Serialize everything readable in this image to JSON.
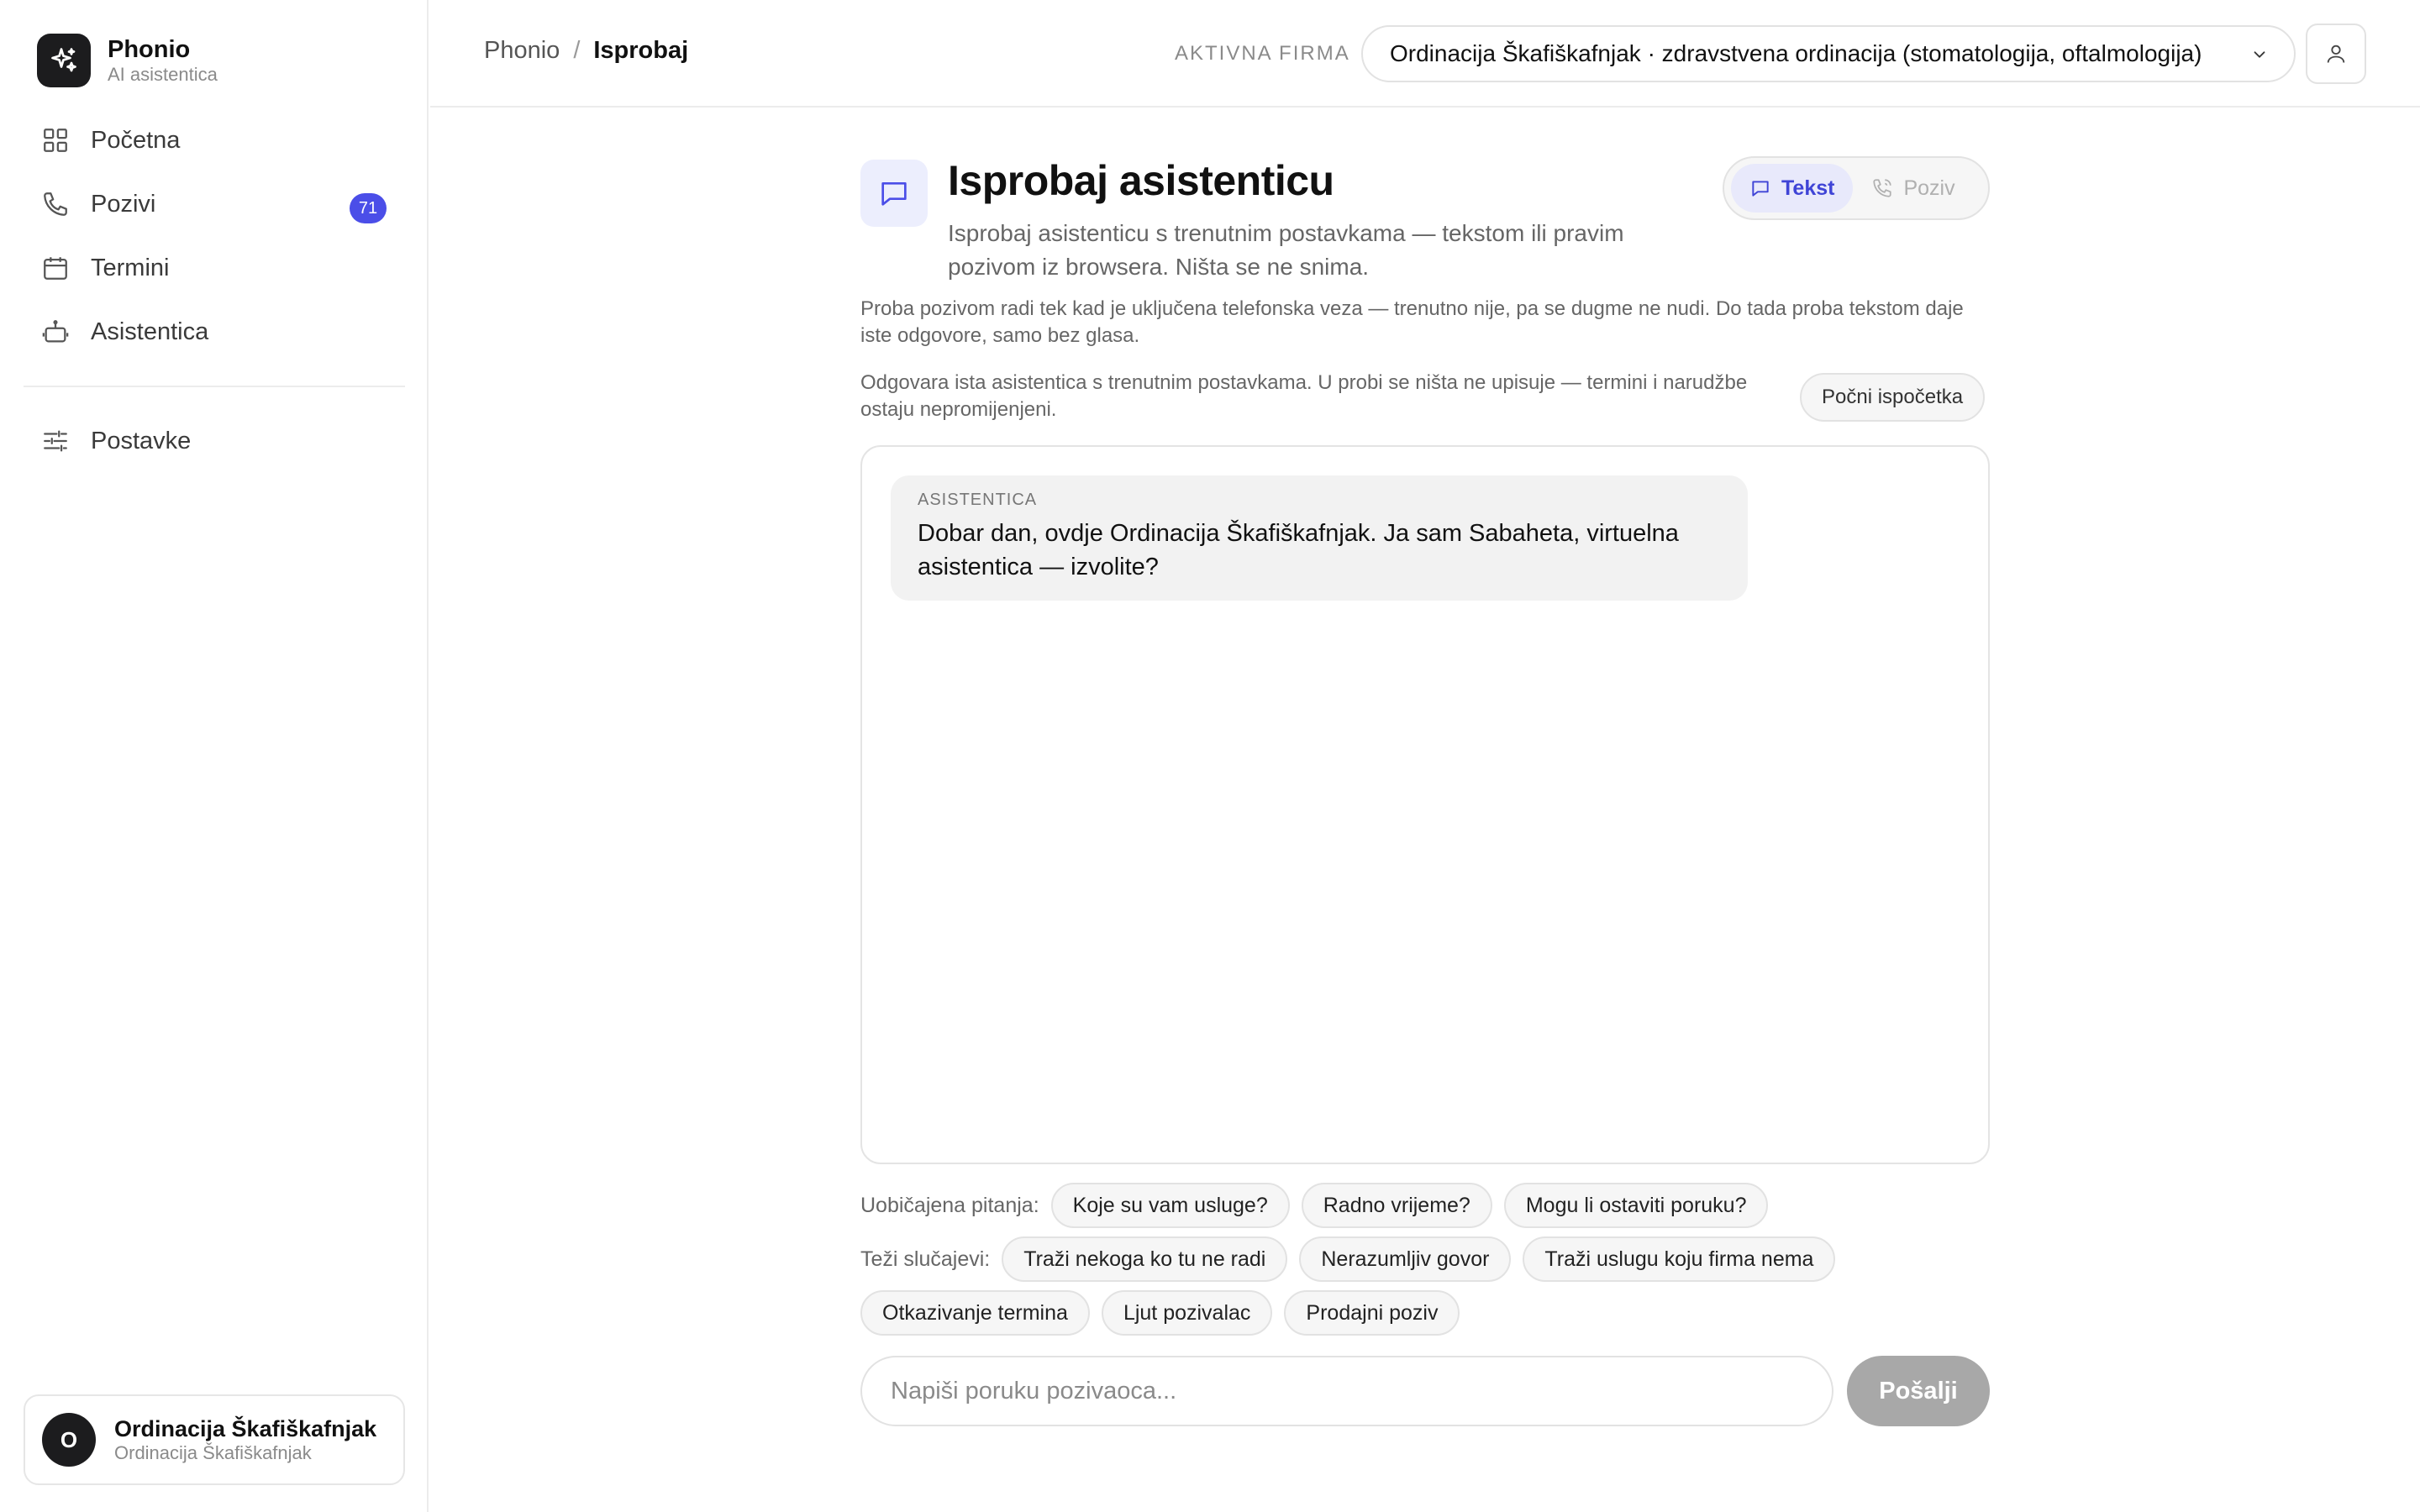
{
  "brand": {
    "name": "Phonio",
    "subtitle": "AI asistentica",
    "icon": "sparkle-icon"
  },
  "sidebar": {
    "items": [
      {
        "label": "Početna",
        "icon": "grid-icon"
      },
      {
        "label": "Pozivi",
        "icon": "phone-icon",
        "badge": "71"
      },
      {
        "label": "Termini",
        "icon": "calendar-icon"
      },
      {
        "label": "Asistentica",
        "icon": "robot-icon"
      }
    ],
    "secondary": [
      {
        "label": "Postavke",
        "icon": "sliders-icon"
      }
    ],
    "account": {
      "initial": "O",
      "name": "Ordinacija Škafiškafnjak",
      "subtitle": "Ordinacija Škafiškafnjak"
    }
  },
  "topbar": {
    "breadcrumb_root": "Phonio",
    "breadcrumb_separator": "/",
    "breadcrumb_current": "Isprobaj",
    "firm_label": "AKTIVNA FIRMA",
    "firm_value": "Ordinacija Škafiškafnjak · zdravstvena ordinacija (stomatologija, oftalmologija)"
  },
  "page": {
    "title": "Isprobaj asistenticu",
    "description": "Isprobaj asistenticu s trenutnim postavkama — tekstom ili pravim pozivom iz browsera. Ništa se ne snima.",
    "mode_text": "Tekst",
    "mode_call": "Poziv",
    "note_call": "Proba pozivom radi tek kad je uključena telefonska veza — trenutno nije, pa se dugme ne nudi. Do tada proba tekstom daje iste odgovore, samo bez glasa.",
    "note_same": "Odgovara ista asistentica s trenutnim postavkama. U probi se ništa ne upisuje — termini i narudžbe ostaju nepromijenjeni.",
    "reset_label": "Počni ispočetka"
  },
  "chat": {
    "messages": [
      {
        "role": "ASISTENTICA",
        "text": "Dobar dan, ovdje Ordinacija Škafiškafnjak. Ja sam Sabaheta, virtuelna asistentica — izvolite?"
      }
    ]
  },
  "suggestions": {
    "common_label": "Uobičajena pitanja:",
    "common": [
      "Koje su vam usluge?",
      "Radno vrijeme?",
      "Mogu li ostaviti poruku?"
    ],
    "hard_label": "Teži slučajevi:",
    "hard": [
      "Traži nekoga ko tu ne radi",
      "Nerazumljiv govor",
      "Traži uslugu koju firma nema",
      "Otkazivanje termina",
      "Ljut pozivalac",
      "Prodajni poziv"
    ]
  },
  "composer": {
    "placeholder": "Napiši poruku pozivaoca...",
    "value": "",
    "send_label": "Pošalji"
  },
  "colors": {
    "accent": "#4b4ee8",
    "accent_soft": "#e8e9fb",
    "send_disabled": "#a8a8a8"
  }
}
